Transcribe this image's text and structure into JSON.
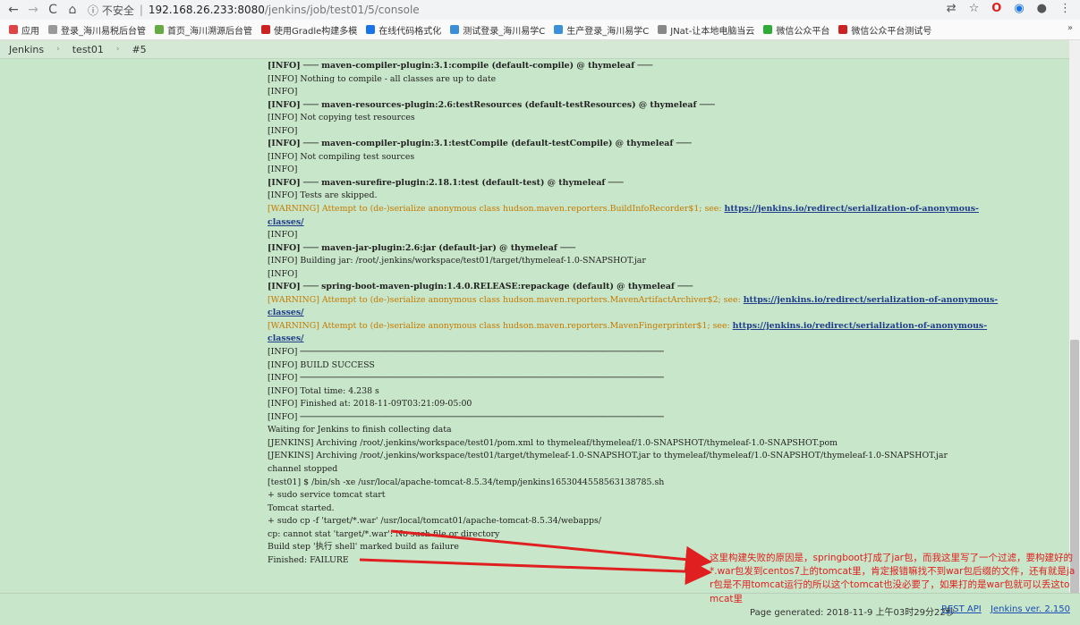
{
  "browser": {
    "back_icon": "arrow-left-icon",
    "forward_icon": "arrow-right-icon",
    "reload_icon": "reload-icon",
    "home_icon": "home-icon",
    "security_label": "ⓘ 不安全",
    "url_host": "192.168.26.233:8080",
    "url_path": "/jenkins/job/test01/5/console"
  },
  "bookmarks": [
    {
      "label": "应用",
      "color": "#d44"
    },
    {
      "label": "登录_海川易税后台管",
      "color": "#999"
    },
    {
      "label": "首页_海川溯源后台管",
      "color": "#6a4"
    },
    {
      "label": "使用Gradle构建多模",
      "color": "#c22"
    },
    {
      "label": "在线代码格式化",
      "color": "#1a73e8"
    },
    {
      "label": "测试登录_海川易学C",
      "color": "#3a8fd8"
    },
    {
      "label": "生产登录_海川易学C",
      "color": "#3a8fd8"
    },
    {
      "label": "JNat-让本地电脑当云",
      "color": "#888"
    },
    {
      "label": "微信公众平台",
      "color": "#2dad38"
    },
    {
      "label": "微信公众平台测试号",
      "color": "#c22"
    }
  ],
  "bookmarks_more": "»",
  "breadcrumb": {
    "jenkins": "Jenkins",
    "job": "test01",
    "build": "#5",
    "separator": "›"
  },
  "console_lines": [
    {
      "t": "[INFO] ─── maven-compiler-plugin:3.1:compile (default-compile) @ thymeleaf ───",
      "k": "n"
    },
    {
      "t": "[INFO] Nothing to compile - all classes are up to date",
      "k": "n"
    },
    {
      "t": "[INFO]",
      "k": "n"
    },
    {
      "t": "[INFO] ─── maven-resources-plugin:2.6:testResources (default-testResources) @ thymeleaf ───",
      "k": "n"
    },
    {
      "t": "[INFO] Not copying test resources",
      "k": "n"
    },
    {
      "t": "[INFO]",
      "k": "n"
    },
    {
      "t": "[INFO] ─── maven-compiler-plugin:3.1:testCompile (default-testCompile) @ thymeleaf ───",
      "k": "n"
    },
    {
      "t": "[INFO] Not compiling test sources",
      "k": "n"
    },
    {
      "t": "[INFO]",
      "k": "n"
    },
    {
      "t": "[INFO] ─── maven-surefire-plugin:2.18.1:test (default-test) @ thymeleaf ───",
      "k": "n"
    },
    {
      "t": "[INFO] Tests are skipped.",
      "k": "n"
    },
    {
      "t": "[WARNING] Attempt to (de-)serialize anonymous class hudson.maven.reporters.BuildInfoRecorder$1; see: ",
      "k": "w",
      "link": "https://jenkins.io/redirect/serialization-of-anonymous-"
    },
    {
      "t": "",
      "k": "n",
      "link": "classes/"
    },
    {
      "t": "[INFO]",
      "k": "n"
    },
    {
      "t": "[INFO] ─── maven-jar-plugin:2.6:jar (default-jar) @ thymeleaf ───",
      "k": "n"
    },
    {
      "t": "[INFO] Building jar: /root/.jenkins/workspace/test01/target/thymeleaf-1.0-SNAPSHOT.jar",
      "k": "n"
    },
    {
      "t": "[INFO]",
      "k": "n"
    },
    {
      "t": "[INFO] ─── spring-boot-maven-plugin:1.4.0.RELEASE:repackage (default) @ thymeleaf ───",
      "k": "n"
    },
    {
      "t": "[WARNING] Attempt to (de-)serialize anonymous class hudson.maven.reporters.MavenArtifactArchiver$2; see: ",
      "k": "w",
      "link": "https://jenkins.io/redirect/serialization-of-anonymous-"
    },
    {
      "t": "",
      "k": "n",
      "link": "classes/"
    },
    {
      "t": "[WARNING] Attempt to (de-)serialize anonymous class hudson.maven.reporters.MavenFingerprinter$1; see: ",
      "k": "w",
      "link": "https://jenkins.io/redirect/serialization-of-anonymous-"
    },
    {
      "t": "",
      "k": "n",
      "link": "classes/"
    },
    {
      "t": "[INFO] ────────────────────────────────────────────────────────────────────────",
      "k": "n"
    },
    {
      "t": "[INFO] BUILD SUCCESS",
      "k": "n"
    },
    {
      "t": "[INFO] ────────────────────────────────────────────────────────────────────────",
      "k": "n"
    },
    {
      "t": "[INFO] Total time:  4.238 s",
      "k": "n"
    },
    {
      "t": "[INFO] Finished at: 2018-11-09T03:21:09-05:00",
      "k": "n"
    },
    {
      "t": "[INFO] ────────────────────────────────────────────────────────────────────────",
      "k": "n"
    },
    {
      "t": "Waiting for Jenkins to finish collecting data",
      "k": "n"
    },
    {
      "t": "[JENKINS] Archiving /root/.jenkins/workspace/test01/pom.xml to thymeleaf/thymeleaf/1.0-SNAPSHOT/thymeleaf-1.0-SNAPSHOT.pom",
      "k": "n"
    },
    {
      "t": "[JENKINS] Archiving /root/.jenkins/workspace/test01/target/thymeleaf-1.0-SNAPSHOT.jar to thymeleaf/thymeleaf/1.0-SNAPSHOT/thymeleaf-1.0-SNAPSHOT.jar",
      "k": "n"
    },
    {
      "t": "channel stopped",
      "k": "n"
    },
    {
      "t": "[test01] $ /bin/sh -xe /usr/local/apache-tomcat-8.5.34/temp/jenkins1653044558563138785.sh",
      "k": "n"
    },
    {
      "t": "+ sudo service tomcat start",
      "k": "n"
    },
    {
      "t": "Tomcat started.",
      "k": "n"
    },
    {
      "t": "+ sudo cp -f 'target/*.war' /usr/local/tomcat01/apache-tomcat-8.5.34/webapps/",
      "k": "n"
    },
    {
      "t": "cp: cannot stat 'target/*.war': No such file or directory",
      "k": "n"
    },
    {
      "t": "Build step '执行 shell' marked build as failure",
      "k": "n"
    },
    {
      "t": "Finished: FAILURE",
      "k": "n"
    }
  ],
  "annotation": "这里构建失败的原因是，springboot打成了jar包，而我这里写了一个过滤，要构建好的*.war包发到centos7上的tomcat里，肯定报错嘛找不到war包后缀的文件，还有就是jar包是不用tomcat运行的所以这个tomcat也没必要了，如果打的是war包就可以丢这tomcat里",
  "footer": {
    "generated": "Page generated: 2018-11-9 上午03时29分22秒",
    "rest_api": "REST API",
    "version": "Jenkins ver. 2.150"
  },
  "colors": {
    "warning": "#c57a00",
    "annotation": "#e02020",
    "background": "#c8e6c9"
  }
}
